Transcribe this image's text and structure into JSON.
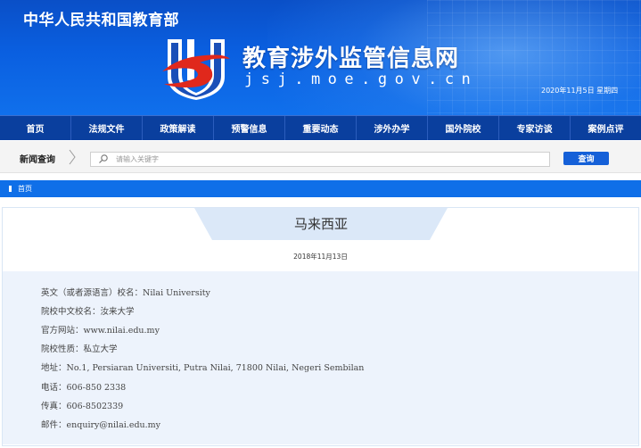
{
  "banner": {
    "ministry_name": "中华人民共和国教育部",
    "site_title": "教育涉外监管信息网",
    "site_domain": "jsj.moe.gov.cn",
    "date_weekday": "2020年11月5日  星期四"
  },
  "nav": {
    "items": [
      "首页",
      "法规文件",
      "政策解读",
      "预警信息",
      "重要动态",
      "涉外办学",
      "国外院校",
      "专家访谈",
      "案例点评"
    ]
  },
  "search": {
    "label": "新闻查询",
    "placeholder": "请输入关键字",
    "button_label": "查询"
  },
  "breadcrumb": {
    "home": "首页"
  },
  "article": {
    "title": "马来西亚",
    "date": "2018年11月13日",
    "fields": [
      {
        "key": "英文（或者源语言）校名：",
        "value": "Nilai University"
      },
      {
        "key": "院校中文校名：",
        "value": "汝来大学"
      },
      {
        "key": "官方网站：",
        "value": "www.nilai.edu.my"
      },
      {
        "key": "院校性质：",
        "value": "私立大学"
      },
      {
        "key": "地址：",
        "value": "No.1, Persiaran Universiti, Putra Nilai, 71800 Nilai, Negeri Sembilan"
      },
      {
        "key": "电话：",
        "value": "606-850 2338"
      },
      {
        "key": "传真：",
        "value": "606-8502339"
      },
      {
        "key": "邮件：",
        "value": "enquiry@nilai.edu.my"
      }
    ]
  },
  "colors": {
    "banner_blue": "#0a5fe0",
    "nav_blue": "#0a3f9e",
    "breadcrumb_blue": "#0f6fe8",
    "logo_red": "#e0281c",
    "content_bg": "#edf3fc"
  }
}
